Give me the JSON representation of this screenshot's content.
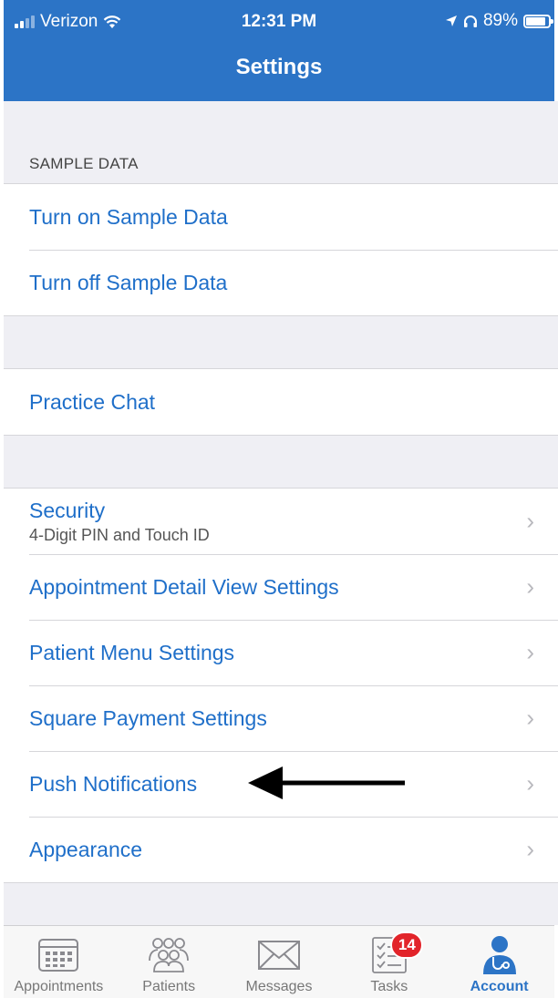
{
  "status_bar": {
    "carrier": "Verizon",
    "time": "12:31 PM",
    "battery": "89%",
    "battery_level": 0.89
  },
  "nav": {
    "title": "Settings"
  },
  "sections": {
    "sample_data": {
      "header": "SAMPLE DATA",
      "items": [
        {
          "label": "Turn on Sample Data"
        },
        {
          "label": "Turn off Sample Data"
        }
      ]
    },
    "chat": {
      "items": [
        {
          "label": "Practice Chat"
        }
      ]
    },
    "settings": {
      "items": [
        {
          "label": "Security",
          "subtitle": "4-Digit PIN and Touch ID"
        },
        {
          "label": "Appointment Detail View Settings"
        },
        {
          "label": "Patient Menu Settings"
        },
        {
          "label": "Square Payment Settings"
        },
        {
          "label": "Push Notifications"
        },
        {
          "label": "Appearance"
        }
      ]
    }
  },
  "tabbar": {
    "items": [
      {
        "label": "Appointments",
        "icon": "calendar-icon"
      },
      {
        "label": "Patients",
        "icon": "people-icon"
      },
      {
        "label": "Messages",
        "icon": "envelope-icon"
      },
      {
        "label": "Tasks",
        "icon": "checklist-icon",
        "badge": "14"
      },
      {
        "label": "Account",
        "icon": "doctor-icon",
        "active": true
      }
    ]
  },
  "colors": {
    "header": "#2c74c6",
    "link": "#1f6fc9",
    "background": "#efeff4",
    "badge": "#e2242a"
  }
}
